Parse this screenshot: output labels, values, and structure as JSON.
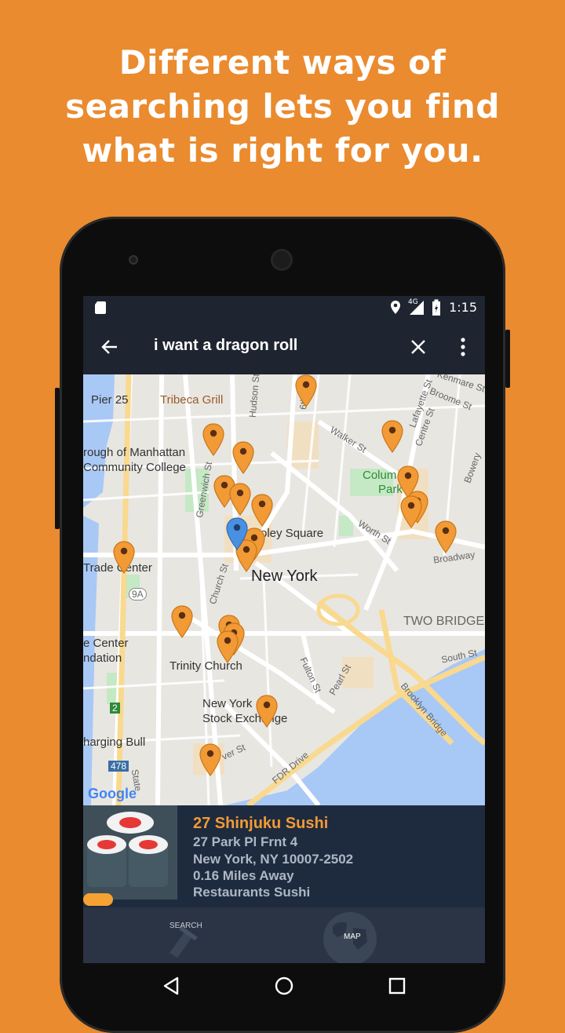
{
  "headline": {
    "line1": "Different ways of",
    "line2": "searching lets you find",
    "line3": "what is right for you."
  },
  "status": {
    "time": "1:15",
    "network": "4G"
  },
  "appbar": {
    "query": "i want a dragon roll"
  },
  "map": {
    "labels": {
      "pier": "Pier 25",
      "tribeca": "Tribeca Grill",
      "borough1": "rough of Manhattan",
      "borough2": "Community College",
      "columbus": "Colum",
      "park": "Park",
      "foley": "oley Square",
      "newyork": "New York",
      "tradecenter": "Trade Center",
      "twobridges": "TWO BRIDGES",
      "center": "e Center",
      "ndation": "ndation",
      "trinity": "Trinity Church",
      "nyse1": "New York",
      "nyse2": "Stock Exchange",
      "bull": "harging Bull",
      "broadway": "Broadway",
      "hudson": "Hudson St",
      "sixth": "6th Ave",
      "walker": "Walker St",
      "worth": "Worth St",
      "lafayette": "Lafayette St",
      "centre": "Centre St",
      "broome": "Broome St",
      "kenmare": "Kenmare St",
      "bowery": "Bowery",
      "church": "Church St",
      "greenwich": "Greenwich St",
      "fulton": "Fulton St",
      "pearl": "Pearl St",
      "south": "South St",
      "brooklynbridge": "Brooklyn Bridge",
      "fdr": "FDR Drive",
      "state": "State",
      "river": "ver St",
      "route9a": "9A",
      "route478": "478",
      "route2": "2",
      "google": "Google"
    }
  },
  "result": {
    "name": "27 Shinjuku Sushi",
    "address1": "27 Park Pl Frnt 4",
    "address2": "New York, NY 10007-2502",
    "distance": "0.16 Miles Away",
    "category": "Restaurants Sushi"
  },
  "tabs": {
    "search": "SEARCH",
    "map": "MAP"
  },
  "colors": {
    "background": "#EA8B2F",
    "accent": "#F29A35",
    "bar": "#1E2430",
    "card": "#1E2B3F"
  }
}
